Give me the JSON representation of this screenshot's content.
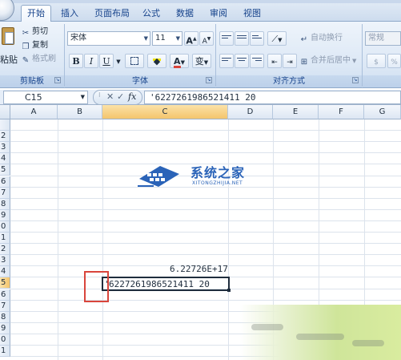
{
  "tabs": [
    {
      "label": "开始",
      "active": true
    },
    {
      "label": "插入",
      "active": false
    },
    {
      "label": "页面布局",
      "active": false
    },
    {
      "label": "公式",
      "active": false
    },
    {
      "label": "数据",
      "active": false
    },
    {
      "label": "审阅",
      "active": false
    },
    {
      "label": "视图",
      "active": false
    }
  ],
  "clipboard": {
    "paste_label": "粘贴",
    "cut_label": "剪切",
    "copy_label": "复制",
    "format_painter_label": "格式刷",
    "caption": "剪贴板"
  },
  "font": {
    "name": "宋体",
    "size": "11",
    "grow_label": "A",
    "shrink_label": "A",
    "bold_label": "B",
    "italic_label": "I",
    "underline_label": "U",
    "font_color_label": "A",
    "phonetic_label": "变",
    "caption": "字体",
    "accent_color": "#d9453c",
    "highlight_color": "#f2e600"
  },
  "alignment": {
    "wrap_label": "自动换行",
    "merge_label": "合并后居中",
    "caption": "对齐方式"
  },
  "number": {
    "format": "常规"
  },
  "formula_bar": {
    "name_box": "C15",
    "cancel_icon": "✕",
    "enter_icon": "✓",
    "fx_label": "fx",
    "formula": "'6227261986521411 20"
  },
  "grid": {
    "columns": [
      "A",
      "B",
      "C",
      "D",
      "E",
      "F",
      "G"
    ],
    "selected_column": "C",
    "row_labels": [
      "",
      "2",
      "3",
      "4",
      "5",
      "6",
      "7",
      "8",
      "9",
      "0",
      "1",
      "2",
      "3",
      "4",
      "5",
      "6",
      "7",
      "8",
      "9",
      "0",
      "1"
    ],
    "selected_row_index": 14,
    "cells": {
      "c14": "6.22726E+17",
      "c15": "6227261986521411 20",
      "b15": "'"
    }
  },
  "watermark": {
    "title": "系统之家",
    "subtitle": "XITONGZHIJIA.NET"
  },
  "colors": {
    "ribbon": "#dbe7f5",
    "selection_header": "#f4c56c",
    "highlight_box": "#d9453c",
    "watermark": "#2a63b8"
  }
}
